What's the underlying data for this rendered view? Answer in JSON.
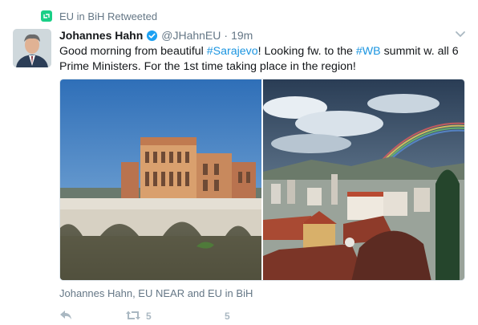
{
  "retweet_context": {
    "icon": "retweet-icon",
    "text": "EU in BiH Retweeted"
  },
  "tweet": {
    "author": {
      "fullname": "Johannes Hahn",
      "verified": true,
      "handle": "@JHahnEU",
      "separator": "·",
      "time": "19m"
    },
    "text": {
      "t1": "Good morning from beautiful ",
      "h1": "#Sarajevo",
      "t2": "! Looking fw. to the ",
      "h2": "#WB",
      "t3": " summit w. all 6 Prime Ministers. For the 1st time taking place in the region!"
    },
    "media": {
      "photos": [
        "Vijecnica city hall and stone bridge",
        "Sarajevo rooftops with rainbow"
      ]
    },
    "media_credit": "Johannes Hahn, EU NEAR and EU in BiH",
    "actions": {
      "reply": {
        "icon": "reply-icon"
      },
      "retweet": {
        "icon": "retweet-icon",
        "count": "5"
      },
      "like": {
        "icon": "heart-icon",
        "count": "5"
      }
    }
  },
  "colors": {
    "link": "#1b95e0",
    "secondary_text": "#657786",
    "retweet_green": "#19cf86",
    "verified_blue": "#1da1f2",
    "action_gray": "#aab8c2"
  }
}
